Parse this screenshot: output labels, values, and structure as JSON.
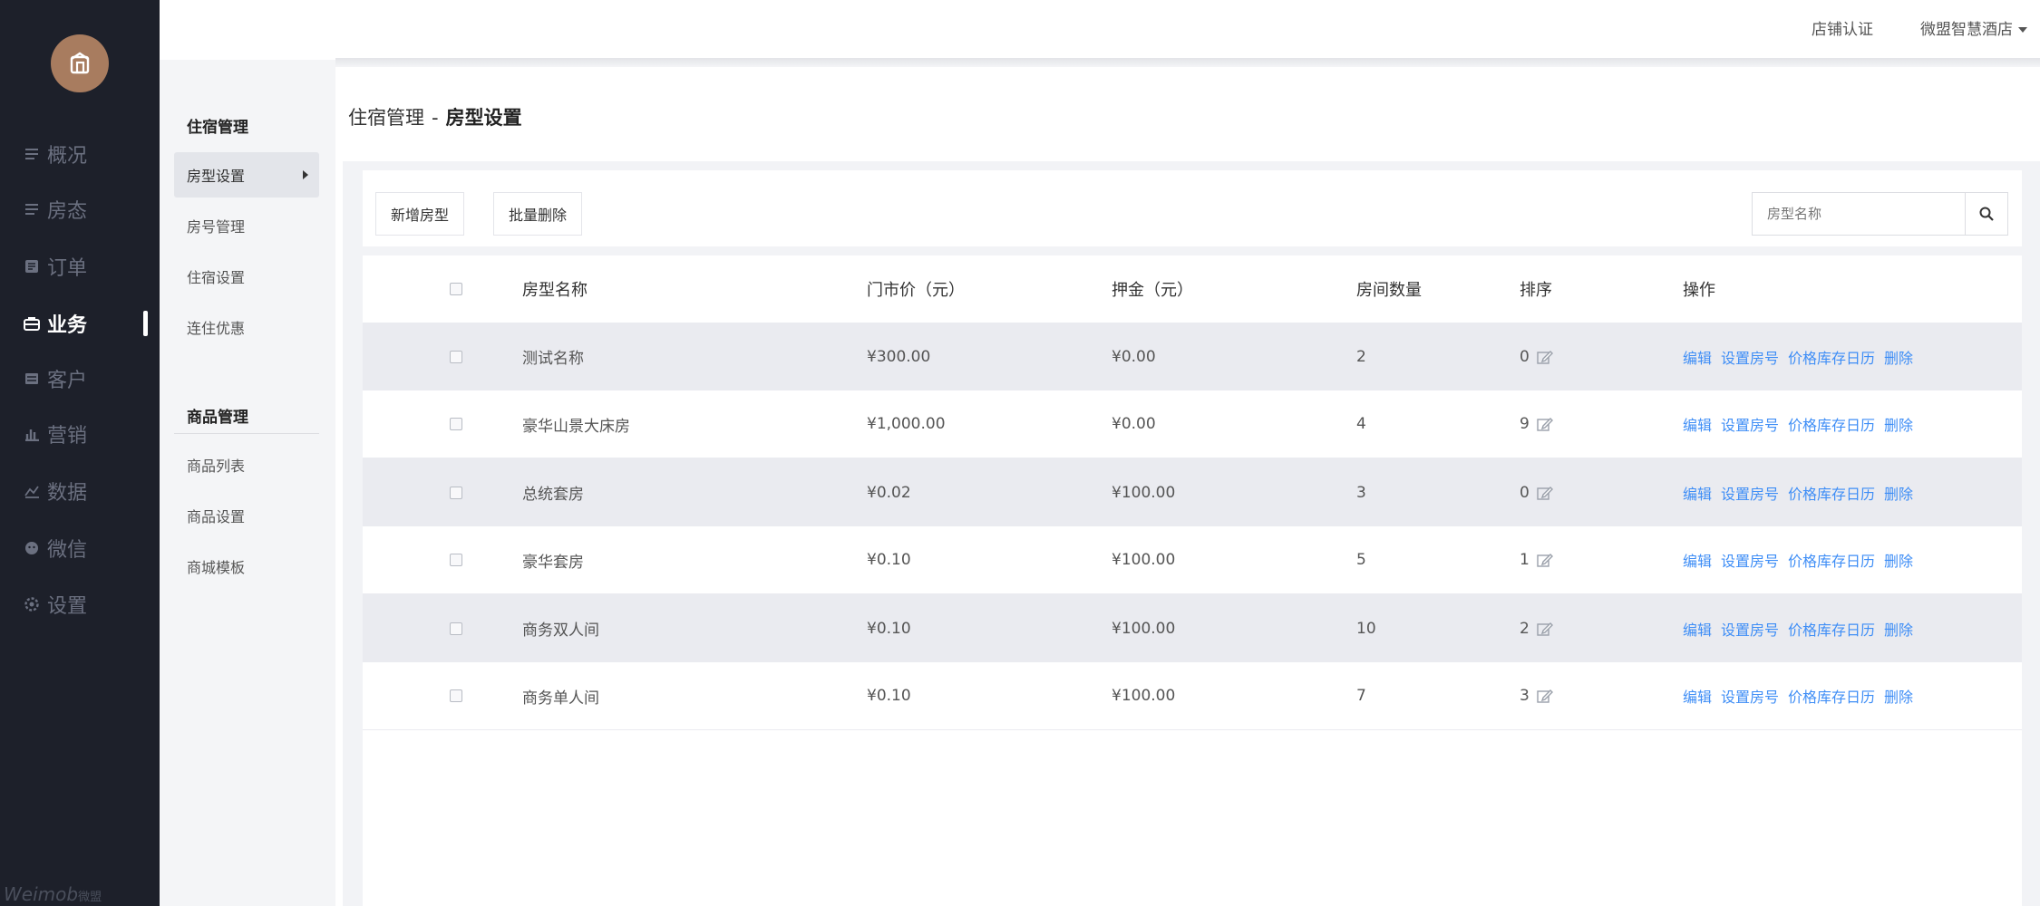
{
  "nav": {
    "items": [
      {
        "label": "概况",
        "icon": "list-icon"
      },
      {
        "label": "房态",
        "icon": "list-icon"
      },
      {
        "label": "订单",
        "icon": "order-icon"
      },
      {
        "label": "业务",
        "icon": "business-icon"
      },
      {
        "label": "客户",
        "icon": "customer-icon"
      },
      {
        "label": "营销",
        "icon": "bar-chart-icon"
      },
      {
        "label": "数据",
        "icon": "line-chart-icon"
      },
      {
        "label": "微信",
        "icon": "wechat-icon"
      },
      {
        "label": "设置",
        "icon": "gear-icon"
      }
    ],
    "active": "业务",
    "brand": "Weimob",
    "brand_cn": "微盟"
  },
  "header": {
    "store_cert": "店铺认证",
    "account": "微盟智慧酒店"
  },
  "subnav": {
    "group1": "住宿管理",
    "group1_items": [
      "房型设置",
      "房号管理",
      "住宿设置",
      "连住优惠"
    ],
    "group2": "商品管理",
    "group2_items": [
      "商品列表",
      "商品设置",
      "商城模板"
    ]
  },
  "breadcrumb": {
    "parent": "住宿管理",
    "separator": "-",
    "current": "房型设置"
  },
  "toolbar": {
    "add_label": "新增房型",
    "bulk_delete_label": "批量删除",
    "search_placeholder": "房型名称"
  },
  "table": {
    "columns": [
      "房型名称",
      "门市价（元）",
      "押金（元）",
      "房间数量",
      "排序",
      "操作"
    ],
    "actions": [
      "编辑",
      "设置房号",
      "价格库存日历",
      "删除"
    ],
    "rows": [
      {
        "name": "测试名称",
        "price": "¥300.00",
        "deposit": "¥0.00",
        "rooms": "2",
        "sort": "0"
      },
      {
        "name": "豪华山景大床房",
        "price": "¥1,000.00",
        "deposit": "¥0.00",
        "rooms": "4",
        "sort": "9"
      },
      {
        "name": "总统套房",
        "price": "¥0.02",
        "deposit": "¥100.00",
        "rooms": "3",
        "sort": "0"
      },
      {
        "name": "豪华套房",
        "price": "¥0.10",
        "deposit": "¥100.00",
        "rooms": "5",
        "sort": "1"
      },
      {
        "name": "商务双人间",
        "price": "¥0.10",
        "deposit": "¥100.00",
        "rooms": "10",
        "sort": "2"
      },
      {
        "name": "商务单人间",
        "price": "¥0.10",
        "deposit": "¥100.00",
        "rooms": "7",
        "sort": "3"
      }
    ]
  }
}
